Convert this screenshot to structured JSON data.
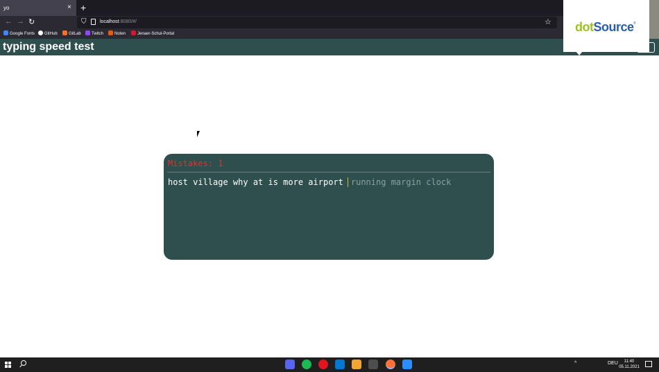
{
  "browser": {
    "tab_title": "yo",
    "tab_close": "×",
    "new_tab": "+",
    "back": "←",
    "forward": "→",
    "reload": "↻",
    "url_host": "localhost",
    "url_path": ":8080/#/",
    "star": "☆",
    "shield": "⛉"
  },
  "bookmarks": [
    {
      "label": "Google Fonts",
      "color": "#4285f4"
    },
    {
      "label": "GitHub",
      "color": "#ffffff"
    },
    {
      "label": "GitLab",
      "color": "#fc6d26"
    },
    {
      "label": "Twitch",
      "color": "#9146ff"
    },
    {
      "label": "Noten",
      "color": "#e8590c"
    },
    {
      "label": "Jenaer-Schul-Portal",
      "color": "#d6182e"
    }
  ],
  "app": {
    "title": "typing speed test"
  },
  "logo": {
    "dot": "dot",
    "source": "Source",
    "reg": "®"
  },
  "test": {
    "mistakes_label": "Mistakes: 1",
    "typed_text": "host village why at is more airport",
    "pending_text": "running margin clock"
  },
  "taskbar": {
    "apps": [
      {
        "name": "discord",
        "color": "#5865f2"
      },
      {
        "name": "spotify",
        "color": "#1db954"
      },
      {
        "name": "opera",
        "color": "#e0161e"
      },
      {
        "name": "vscode",
        "color": "#0078d4"
      },
      {
        "name": "intellij",
        "color": "#f0a732"
      },
      {
        "name": "terminal",
        "color": "#4d4d4d"
      },
      {
        "name": "firefox",
        "color": "#ff7139"
      },
      {
        "name": "zoom",
        "color": "#2d8cff"
      }
    ],
    "tray_chevron": "^",
    "tray_lang": "DEU",
    "time": "11:40",
    "date": "05.11.2021"
  },
  "colors": {
    "accent": "#2f4f4f",
    "mistakes": "#e2312a",
    "caret": "#d7b72a"
  }
}
